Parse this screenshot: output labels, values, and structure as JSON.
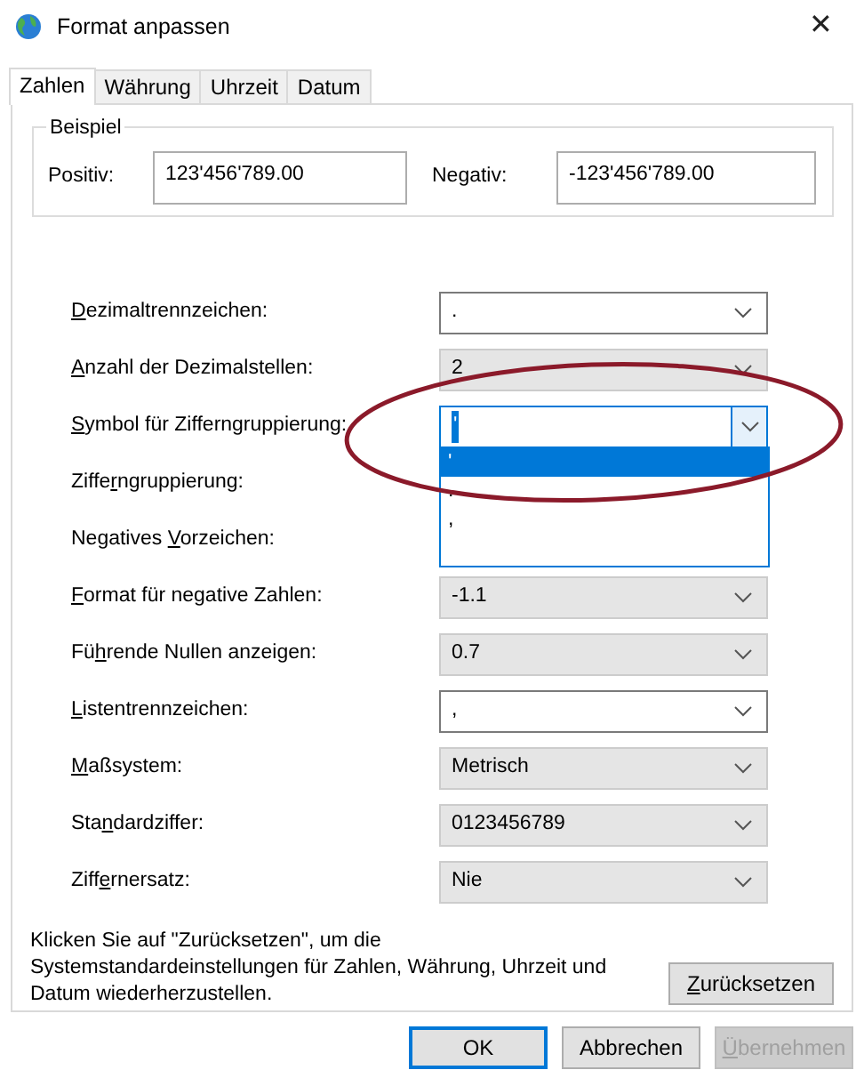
{
  "window": {
    "title": "Format anpassen",
    "close": "✕"
  },
  "tabs": [
    {
      "label": "Zahlen",
      "selected": true
    },
    {
      "label": "Währung",
      "selected": false
    },
    {
      "label": "Uhrzeit",
      "selected": false
    },
    {
      "label": "Datum",
      "selected": false
    }
  ],
  "example": {
    "title": "Beispiel",
    "positive_label": "Positiv:",
    "positive_value": "123'456'789.00",
    "negative_label": "Negativ:",
    "negative_value": "-123'456'789.00"
  },
  "settings": [
    {
      "label": {
        "key": "D",
        "post": "ezimaltrennzeichen:"
      },
      "value": ".",
      "disabled": false,
      "open": false
    },
    {
      "label": {
        "key": "A",
        "post": "nzahl der Dezimalstellen:"
      },
      "value": "2",
      "disabled": true,
      "open": false
    },
    {
      "label": {
        "key": "S",
        "post": "ymbol für Zifferngruppierung:"
      },
      "value": "'",
      "disabled": false,
      "open": true
    },
    {
      "label": {
        "pre": "Ziffe",
        "key": "r",
        "post": "ngruppierung:"
      }
    },
    {
      "label": {
        "pre": "Negatives ",
        "key": "V",
        "post": "orzeichen:"
      }
    },
    {
      "label": {
        "key": "F",
        "post": "ormat für negative Zahlen:"
      },
      "value": "-1.1",
      "disabled": true,
      "open": false
    },
    {
      "label": {
        "pre": "Fü",
        "key": "h",
        "post": "rende Nullen anzeigen:"
      },
      "value": "0.7",
      "disabled": true,
      "open": false
    },
    {
      "label": {
        "key": "L",
        "post": "istentrennzeichen:"
      },
      "value": ",",
      "disabled": false,
      "open": false
    },
    {
      "label": {
        "key": "M",
        "post": "aßsystem:"
      },
      "value": "Metrisch",
      "disabled": true,
      "open": false
    },
    {
      "label": {
        "pre": "Sta",
        "key": "n",
        "post": "dardziffer:"
      },
      "value": "0123456789",
      "disabled": true,
      "open": false
    },
    {
      "label": {
        "pre": "Ziff",
        "key": "e",
        "post": "rnersatz:"
      },
      "value": "Nie",
      "disabled": true,
      "open": false
    }
  ],
  "dropdown": {
    "options": [
      {
        "label": "'",
        "selected": true
      },
      {
        "label": ".",
        "selected": false
      },
      {
        "label": ",",
        "selected": false
      }
    ]
  },
  "annotation": {
    "kind": "ellipse"
  },
  "reset": {
    "text": "Klicken Sie auf \"Zurücksetzen\", um die Systemstandardeinstellungen für Zahlen, Währung, Uhrzeit und Datum wiederherzustellen.",
    "button": {
      "key": "Z",
      "post": "urücksetzen"
    }
  },
  "buttons": [
    {
      "label": {
        "pre": "OK"
      },
      "default": true,
      "disabled": false
    },
    {
      "label": {
        "pre": "Abbrechen"
      },
      "default": false,
      "disabled": false
    },
    {
      "label": {
        "key": "Ü",
        "post": "bernehmen"
      },
      "default": false,
      "disabled": true
    }
  ]
}
